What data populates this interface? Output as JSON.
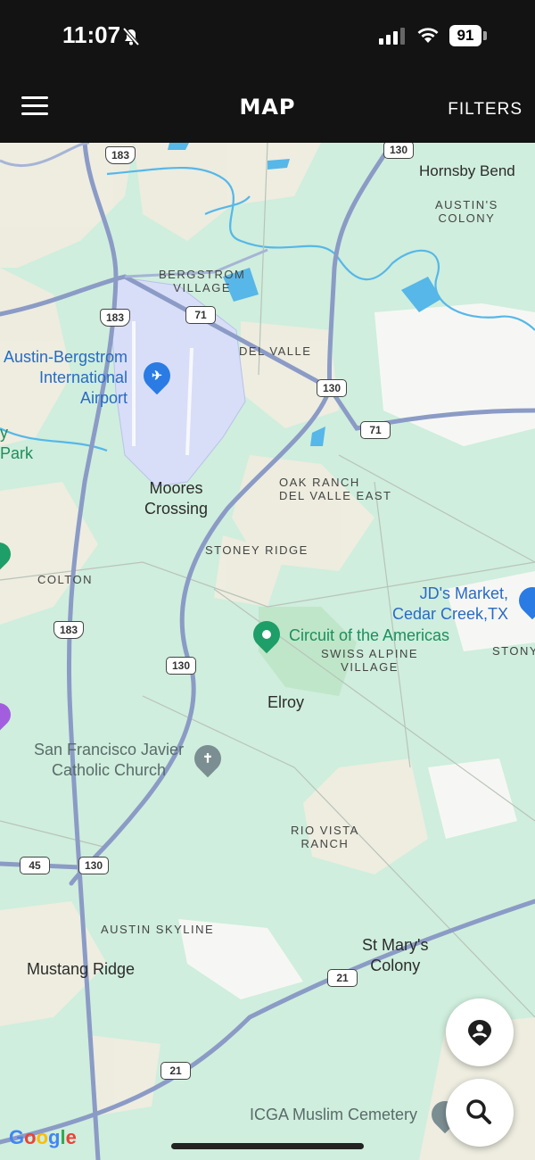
{
  "status": {
    "time": "11:07",
    "battery": "91"
  },
  "header": {
    "title": "MAP",
    "filters_label": "FILTERS"
  },
  "map": {
    "shields": {
      "us183_top": "183",
      "sh130_top": "130",
      "us183_mid": "183",
      "sh71_a": "71",
      "sh130_b": "130",
      "sh71_b": "71",
      "us183_low": "183",
      "sh130_c": "130",
      "fm45": "45",
      "sh130_d": "130",
      "fm21_a": "21",
      "fm21_b": "21"
    },
    "labels": {
      "hornsby_bend": "Hornsby Bend",
      "austins_colony": "AUSTIN'S\nCOLONY",
      "bergstrom_village": "BERGSTROM\nVILLAGE",
      "del_valle": "DEL VALLE",
      "airport": "Austin-Bergstrom\nInternational\nAirport",
      "park": "y\nPark",
      "moores_crossing": "Moores\nCrossing",
      "oak_ranch": "OAK RANCH\nDEL VALLE EAST",
      "stoney_ridge": "STONEY RIDGE",
      "colton": "COLTON",
      "jds_market": "JD's Market,\nCedar Creek,TX",
      "stony": "STONY",
      "cota": "Circuit of the Americas",
      "swiss_alpine": "SWISS ALPINE\nVILLAGE",
      "elroy": "Elroy",
      "sf_javier": "San Francisco Javier\nCatholic Church",
      "rio_vista": "RIO VISTA\nRANCH",
      "austin_skyline": "AUSTIN SKYLINE",
      "mustang_ridge": "Mustang Ridge",
      "st_marys": "St Mary's\nColony",
      "icga": "ICGA Muslim Cemetery"
    },
    "google_logo": "Google"
  },
  "colors": {
    "bar": "#131313",
    "map_bg": "#cfeedd",
    "road": "#8b9bc6",
    "airport": "#d8def7",
    "water": "#56b7e8"
  }
}
